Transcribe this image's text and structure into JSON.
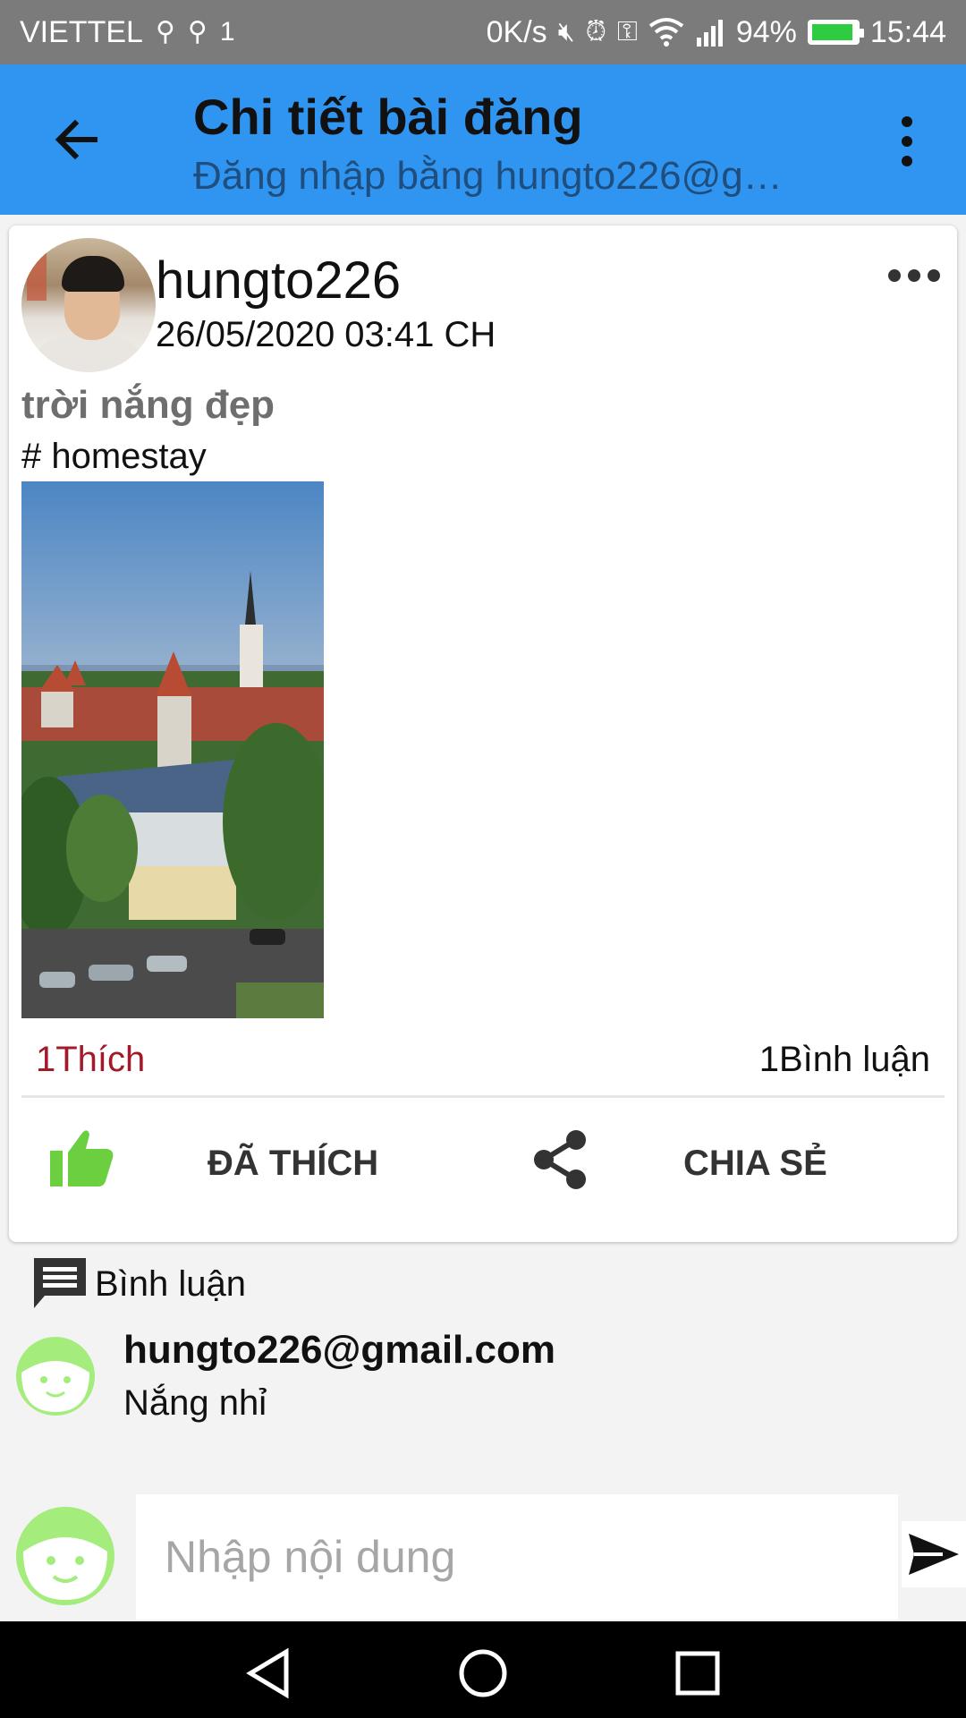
{
  "status_bar": {
    "carrier": "VIETTEL",
    "net_speed": "0K/s",
    "battery_percent": "94%",
    "time": "15:44",
    "battery_fill": 0.94
  },
  "app_bar": {
    "title": "Chi tiết bài đăng",
    "subtitle": "Đăng nhập bằng hungto226@g…"
  },
  "post": {
    "username": "hungto226",
    "date": "26/05/2020 03:41 CH",
    "text": "trời nắng đẹp",
    "tag": "# homestay",
    "likes": "1Thích",
    "comments": "1Bình luận",
    "like_label": "ĐÃ THÍCH",
    "share_label": "CHIA SẺ"
  },
  "comments_section": {
    "header": "Bình luận",
    "items": [
      {
        "author": "hungto226@gmail.com",
        "text": "Nắng nhỉ"
      }
    ]
  },
  "comment_input": {
    "placeholder": "Nhập nội dung"
  },
  "colors": {
    "app_bar": "#2f95f0",
    "status_bar": "#7b7b7b",
    "likes_text": "#a3192a",
    "like_icon": "#6ccf3f",
    "smiley": "#a4ec7c"
  },
  "icons": {
    "back": "arrow-back-icon",
    "overflow": "more-vert-icon",
    "post_more": "more-horiz-icon",
    "like": "thumb-up-icon",
    "share": "share-icon",
    "comment": "comment-icon",
    "avatar": "smiley-face-icon",
    "send": "send-icon"
  }
}
